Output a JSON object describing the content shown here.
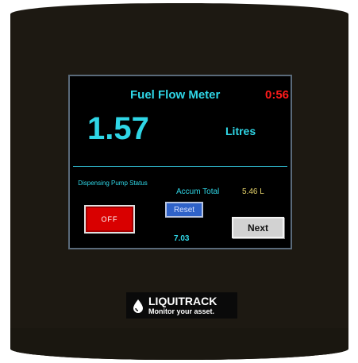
{
  "screen": {
    "title": "Fuel Flow Meter",
    "timer": "0:56",
    "reading_value": "1.57",
    "reading_unit": "Litres",
    "pump_status_label": "Dispensing Pump Status",
    "pump_button_label": "OFF",
    "accum_total_label": "Accum Total",
    "accum_total_value": "5.46 L",
    "reset_button_label": "Reset",
    "counter_value": "7.03",
    "next_button_label": "Next"
  },
  "branding": {
    "name": "LIQUITRACK",
    "tagline": "Monitor your asset.",
    "icon": "droplet-icon"
  },
  "colors": {
    "accent_cyan": "#2fd6e6",
    "timer_red": "#ff1b1b",
    "pump_off_red": "#d90000",
    "accum_value_yellow": "#e6d36a",
    "reset_blue": "#2f62c8"
  }
}
